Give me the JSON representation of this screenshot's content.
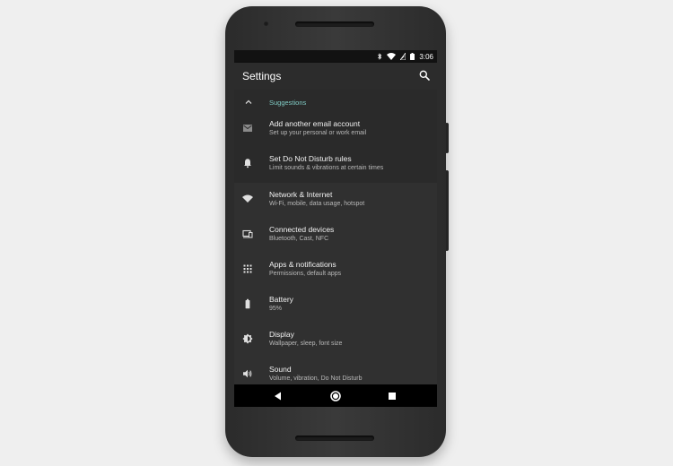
{
  "status_bar": {
    "time": "3:06",
    "icons": [
      "bluetooth-icon",
      "wifi-icon",
      "signal-icon",
      "battery-icon"
    ]
  },
  "app_bar": {
    "title": "Settings",
    "search_icon": "search-icon"
  },
  "suggestions": {
    "title": "Suggestions",
    "items": [
      {
        "title": "Add another email account",
        "subtitle": "Set up your personal or work email",
        "icon": "email-icon"
      },
      {
        "title": "Set Do Not Disturb rules",
        "subtitle": "Limit sounds & vibrations at certain times",
        "icon": "bell-icon"
      }
    ]
  },
  "settings": {
    "items": [
      {
        "title": "Network & Internet",
        "subtitle": "Wi-Fi, mobile, data usage, hotspot",
        "icon": "wifi-icon"
      },
      {
        "title": "Connected devices",
        "subtitle": "Bluetooth, Cast, NFC",
        "icon": "devices-icon"
      },
      {
        "title": "Apps & notifications",
        "subtitle": "Permissions, default apps",
        "icon": "apps-grid-icon"
      },
      {
        "title": "Battery",
        "subtitle": "95%",
        "icon": "battery-icon"
      },
      {
        "title": "Display",
        "subtitle": "Wallpaper, sleep, font size",
        "icon": "brightness-icon"
      },
      {
        "title": "Sound",
        "subtitle": "Volume, vibration, Do Not Disturb",
        "icon": "volume-icon"
      }
    ]
  },
  "nav_bar": {
    "buttons": [
      "back-icon",
      "home-icon",
      "recents-icon"
    ]
  },
  "colors": {
    "accent": "#80cbc4",
    "background": "#303030",
    "suggestion_background": "#2a2a2a",
    "status_bar": "#121212",
    "nav_bar": "#000000"
  }
}
